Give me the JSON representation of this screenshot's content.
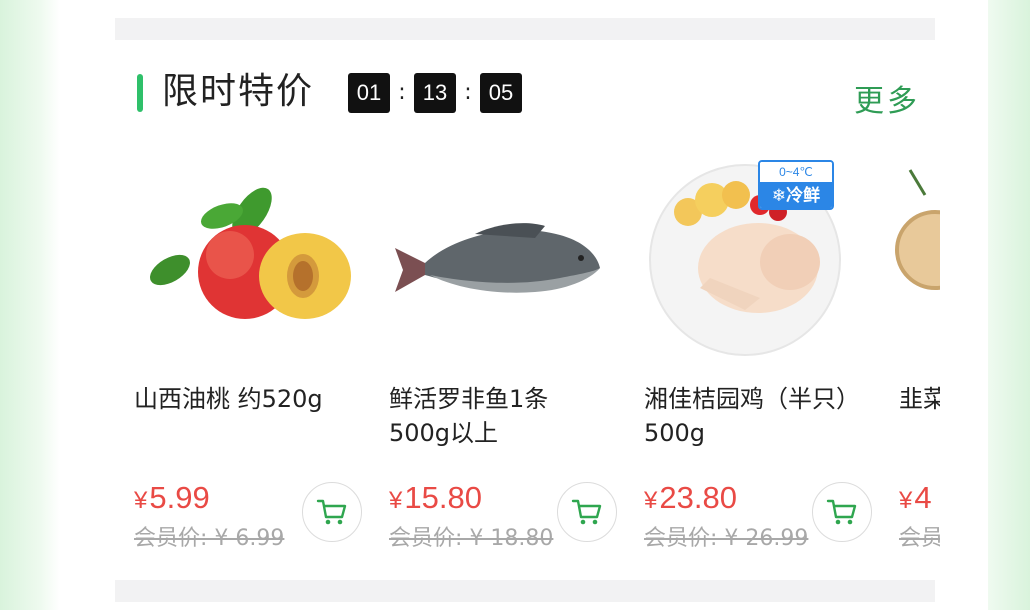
{
  "section": {
    "title": "限时特价",
    "more_label": "更多",
    "timer": {
      "hours": "01",
      "minutes": "13",
      "seconds": "05",
      "separator": ":"
    }
  },
  "products": [
    {
      "name": "山西油桃 约520g",
      "price_symbol": "¥",
      "price": "5.99",
      "member_price": "会员价: ¥ 6.99"
    },
    {
      "name": "鲜活罗非鱼1条\n500g以上",
      "price_symbol": "¥",
      "price": "15.80",
      "member_price": "会员价: ¥ 18.80"
    },
    {
      "name": "湘佳桔园鸡（半只）\n500g",
      "price_symbol": "¥",
      "price": "23.80",
      "member_price": "会员价: ¥ 26.99",
      "badge": {
        "temp": "0~4℃",
        "label": "❄冷鲜"
      }
    },
    {
      "name": "韭菜",
      "price_symbol": "¥",
      "price": "4",
      "member_price": "会员"
    }
  ],
  "colors": {
    "accent_green": "#2fc06a",
    "more_green": "#2f9c55",
    "price_red": "#e94a45",
    "badge_blue": "#2b86e6"
  }
}
